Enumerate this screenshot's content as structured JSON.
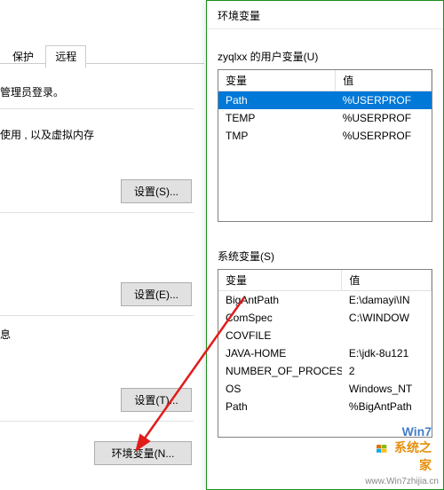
{
  "back": {
    "tab_protect": "保护",
    "tab_remote": "远程",
    "line_admin": "管理员登录。",
    "line_vm": "使用 , 以及虚拟内存",
    "btn_s": "设置(S)...",
    "btn_e": "设置(E)...",
    "btn_t": "设置(T)...",
    "btn_env": "环境变量(N...",
    "section_info_tail": "息"
  },
  "env": {
    "title": "环境变量",
    "user_group": "zyqlxx 的用户变量(U)",
    "sys_group": "系统变量(S)",
    "col_var": "变量",
    "col_val": "值",
    "user_vars": [
      {
        "name": "Path",
        "value": "%USERPROF",
        "selected": true
      },
      {
        "name": "TEMP",
        "value": "%USERPROF",
        "selected": false
      },
      {
        "name": "TMP",
        "value": "%USERPROF",
        "selected": false
      }
    ],
    "sys_vars": [
      {
        "name": "BigAntPath",
        "value": "E:\\damayi\\IN"
      },
      {
        "name": "ComSpec",
        "value": "C:\\WINDOW"
      },
      {
        "name": "COVFILE",
        "value": ""
      },
      {
        "name": "JAVA-HOME",
        "value": "E:\\jdk-8u121"
      },
      {
        "name": "NUMBER_OF_PROCESSORS",
        "value": "2"
      },
      {
        "name": "OS",
        "value": "Windows_NT"
      },
      {
        "name": "Path",
        "value": "%BigAntPath"
      }
    ]
  },
  "watermark": {
    "line1_a": "Win7",
    "line1_b": "系统之家",
    "line2": "www.Win7zhijia.cn"
  }
}
